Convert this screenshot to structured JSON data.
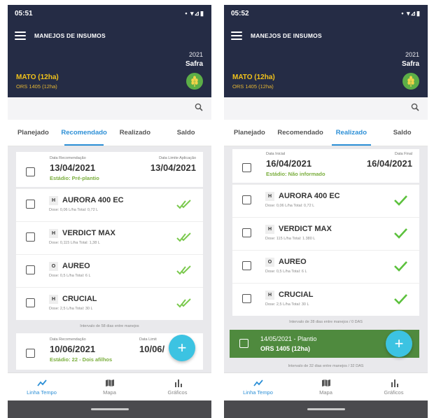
{
  "screens": [
    {
      "status": {
        "time": "05:51",
        "dot": "•",
        "icons": "• ▾⊿▮"
      },
      "appbar": {
        "title": "MANEJOS DE INSUMOS",
        "year": "2021",
        "safra": "Safra",
        "crop": "MATO (12ha)",
        "crop_sub": "ORS 1405 (12ha)"
      },
      "tabs": [
        "Planejado",
        "Recomendado",
        "Realizado",
        "Saldo"
      ],
      "active_tab": 1,
      "header_card": {
        "left_label": "Data Recomendação",
        "left_date": "13/04/2021",
        "right_label": "Data Limite Aplicação",
        "right_date": "13/04/2021",
        "stadium": "Estádio: Pré-plantio"
      },
      "products": [
        {
          "badge": "H",
          "name": "AURORA 400 EC",
          "dose": "Dose: 0,06 L/ha   Total: 0,72 L"
        },
        {
          "badge": "H",
          "name": "VERDICT MAX",
          "dose": "Dose: 0,115 L/ha   Total: 1,38 L"
        },
        {
          "badge": "O",
          "name": "AUREO",
          "dose": "Dose: 0,5 L/ha   Total: 6 L"
        },
        {
          "badge": "H",
          "name": "CRUCIAL",
          "dose": "Dose: 2,5 L/ha   Total: 30 L"
        }
      ],
      "interval": "Intervalo de 58 dias entre manejos",
      "next_card": {
        "left_label": "Data Recomendação",
        "left_date": "10/06/2021",
        "right_label": "Data Limit",
        "right_date": "10/06/",
        "stadium": "Estádio: 22 - Dois afilhos"
      },
      "fab": "+",
      "nav": [
        {
          "label": "Linha Tempo",
          "icon": "timeline-icon"
        },
        {
          "label": "Mapa",
          "icon": "map-icon"
        },
        {
          "label": "Gráficos",
          "icon": "bar-chart-icon"
        }
      ]
    },
    {
      "status": {
        "time": "05:52",
        "dot": "•",
        "icons": "• ▾⊿▮"
      },
      "appbar": {
        "title": "MANEJOS DE INSUMOS",
        "year": "2021",
        "safra": "Safra",
        "crop": "MATO (12ha)",
        "crop_sub": "ORS 1405 (12ha)"
      },
      "tabs": [
        "Planejado",
        "Recomendado",
        "Realizado",
        "Saldo"
      ],
      "active_tab": 2,
      "header_card": {
        "left_label": "Data Inicial",
        "left_date": "16/04/2021",
        "right_label": "Data Final",
        "right_date": "16/04/2021",
        "stadium": "Estádio: Não informado"
      },
      "products": [
        {
          "badge": "H",
          "name": "AURORA 400 EC",
          "dose": "Dose: 0,06 L/ha   Total: 0,72 L"
        },
        {
          "badge": "H",
          "name": "VERDICT MAX",
          "dose": "Dose: 115 L/ha   Total: 1.380 L"
        },
        {
          "badge": "O",
          "name": "AUREO",
          "dose": "Dose: 0,5 L/ha   Total: 6 L"
        },
        {
          "badge": "H",
          "name": "CRUCIAL",
          "dose": "Dose: 2,5 L/ha   Total: 30 L"
        }
      ],
      "interval": "Intervalo de 28 dias entre manejos / 0 DAS",
      "green_card": {
        "title": "14/05/2021 - Plantio",
        "sub": "ORS 1405 (12ha)"
      },
      "interval2": "Intervalo de 32 dias entre manejos / 32 DAS",
      "fab": "+",
      "nav": [
        {
          "label": "Linha Tempo",
          "icon": "timeline-icon"
        },
        {
          "label": "Mapa",
          "icon": "map-icon"
        },
        {
          "label": "Gráficos",
          "icon": "bar-chart-icon"
        }
      ]
    }
  ],
  "colors": {
    "appbar": "#252c45",
    "accent": "#2c8fd6",
    "crop": "#f1c21b",
    "check": "#7ac94d",
    "fab": "#3cc3e2",
    "green_card": "#4f8a3e"
  }
}
